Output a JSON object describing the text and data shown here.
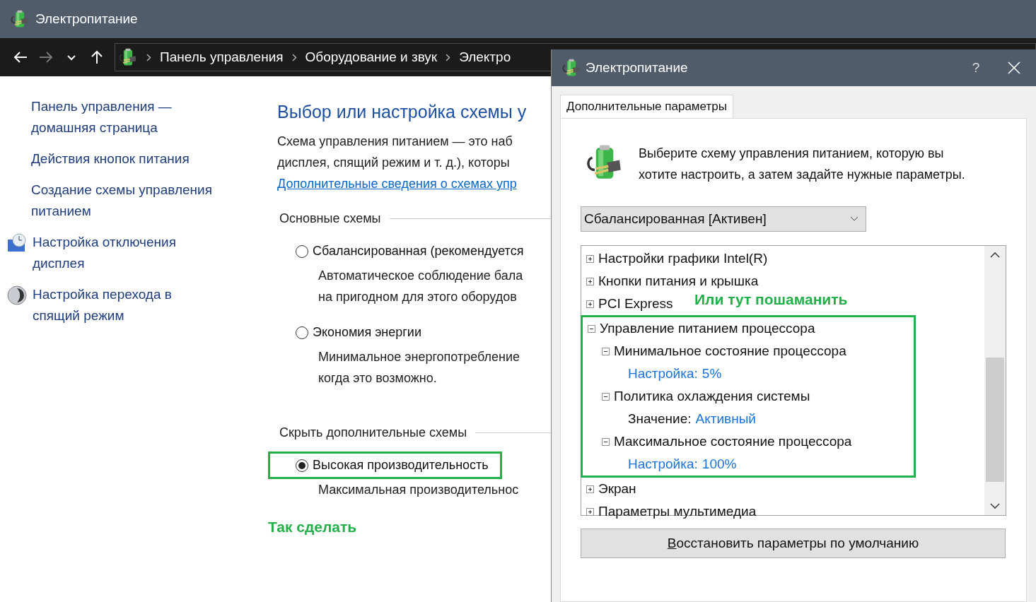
{
  "window": {
    "title": "Электропитание"
  },
  "nav": {
    "back_enabled": true,
    "forward_enabled": false,
    "breadcrumb": [
      "Панель управления",
      "Оборудование и звук",
      "Электро"
    ]
  },
  "sidebar": {
    "items": [
      {
        "kind": "plain",
        "label": "Панель управления — домашняя страница"
      },
      {
        "kind": "plain",
        "label": "Действия кнопок питания"
      },
      {
        "kind": "plain",
        "label": "Создание схемы управления питанием"
      },
      {
        "kind": "display",
        "label": "Настройка отключения дисплея"
      },
      {
        "kind": "sleep",
        "label": "Настройка перехода в спящий режим"
      }
    ]
  },
  "content": {
    "heading": "Выбор или настройка схемы у",
    "description": [
      "Схема управления питанием — это наб",
      "дисплея, спящий режим и т. д.), которы"
    ],
    "link": "Дополнительные сведения о схемах упр",
    "groups": [
      {
        "title": "Основные схемы",
        "schemes": [
          {
            "name": "Сбалансированная (рекомендуется",
            "description": [
              "Автоматическое соблюдение бала",
              "на пригодном для этого оборудов"
            ],
            "selected": false,
            "highlighted": false
          },
          {
            "name": "Экономия энергии",
            "description": [
              "Минимальное энергопотребление",
              "когда это возможно."
            ],
            "selected": false,
            "highlighted": false
          }
        ]
      },
      {
        "title": "Скрыть дополнительные схемы",
        "schemes": [
          {
            "name": "Высокая производительность",
            "description": [
              "Максимальная производительнос"
            ],
            "selected": true,
            "highlighted": true
          }
        ]
      }
    ],
    "annotation": "Так сделать"
  },
  "dialog": {
    "title": "Электропитание",
    "help": "?",
    "tabs": [
      {
        "label": "Дополнительные параметры",
        "selected": true
      }
    ],
    "intro": "Выберите схему управления питанием, которую вы хотите настроить, а затем задайте нужные параметры.",
    "plan_dropdown": {
      "value": "Сбалансированная [Активен]"
    },
    "settings_tree": [
      {
        "kind": "group",
        "label": "Настройки графики Intel(R)",
        "expanded": false,
        "highlighted": false
      },
      {
        "kind": "group",
        "label": "Кнопки питания и крышка",
        "expanded": false,
        "highlighted": false
      },
      {
        "kind": "group",
        "label": "PCI Express",
        "expanded": false,
        "highlighted": false
      },
      {
        "kind": "group",
        "label": "Управление питанием процессора",
        "expanded": true,
        "highlighted": true,
        "children": [
          {
            "kind": "group",
            "label": "Минимальное состояние процессора",
            "expanded": true,
            "highlighted": false,
            "children": [
              {
                "kind": "setting",
                "label": "Настройка:",
                "value": "5%",
                "label_linked": true
              }
            ]
          },
          {
            "kind": "group",
            "label": "Политика охлаждения системы",
            "expanded": true,
            "highlighted": false,
            "children": [
              {
                "kind": "setting",
                "label": "Значение:",
                "value": "Активный",
                "label_linked": false
              }
            ]
          },
          {
            "kind": "group",
            "label": "Максимальное состояние процессора",
            "expanded": true,
            "highlighted": false,
            "children": [
              {
                "kind": "setting",
                "label": "Настройка:",
                "value": "100%",
                "label_linked": true
              }
            ]
          }
        ]
      },
      {
        "kind": "group",
        "label": "Экран",
        "expanded": false,
        "highlighted": false
      },
      {
        "kind": "group",
        "label": "Параметры мультимедиа",
        "expanded": false,
        "highlighted": false
      }
    ],
    "annotation": "Или тут пошаманить",
    "restore_button": {
      "label": "Восстановить параметры по умолчанию",
      "access_key_underlined": true
    }
  }
}
